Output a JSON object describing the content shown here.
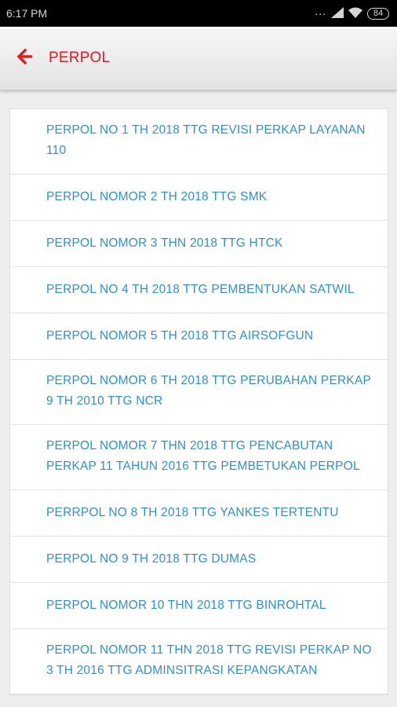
{
  "status_bar": {
    "time": "6:17 PM",
    "dots": "...",
    "battery": "84",
    "signal_icon": "signal-icon",
    "wifi_icon": "wifi-icon"
  },
  "app_bar": {
    "title": "PERPOL",
    "back_icon": "arrow-left-icon",
    "accent_color": "#e8171f"
  },
  "colors": {
    "link": "#2f8fce"
  },
  "items": [
    {
      "label": "PERPOL NO 1 TH 2018 TTG REVISI PERKAP LAYANAN 110"
    },
    {
      "label": "PERPOL NOMOR 2 TH 2018 TTG SMK"
    },
    {
      "label": "PERPOL NOMOR 3 THN 2018 TTG HTCK"
    },
    {
      "label": "PERPOL NO 4 TH 2018 TTG PEMBENTUKAN SATWIL"
    },
    {
      "label": "PERPOL NOMOR 5 TH 2018 TTG AIRSOFGUN"
    },
    {
      "label": "PERPOL NOMOR 6 TH 2018 TTG PERUBAHAN PERKAP 9 TH 2010 TTG NCR"
    },
    {
      "label": "PERPOL NOMOR 7 THN 2018 TTG PENCABUTAN PERKAP 11 TAHUN 2016 TTG PEMBETUKAN PERPOL"
    },
    {
      "label": "PERRPOL NO 8 TH 2018 TTG YANKES TERTENTU"
    },
    {
      "label": "PERPOL NO 9 TH 2018 TTG DUMAS"
    },
    {
      "label": "PERPOL NOMOR 10 THN 2018 TTG BINROHTAL"
    },
    {
      "label": "PERPOL NOMOR 11 THN 2018 TTG REVISI PERKAP NO 3 TH 2016 TTG ADMINSITRASI KEPANGKATAN"
    }
  ]
}
